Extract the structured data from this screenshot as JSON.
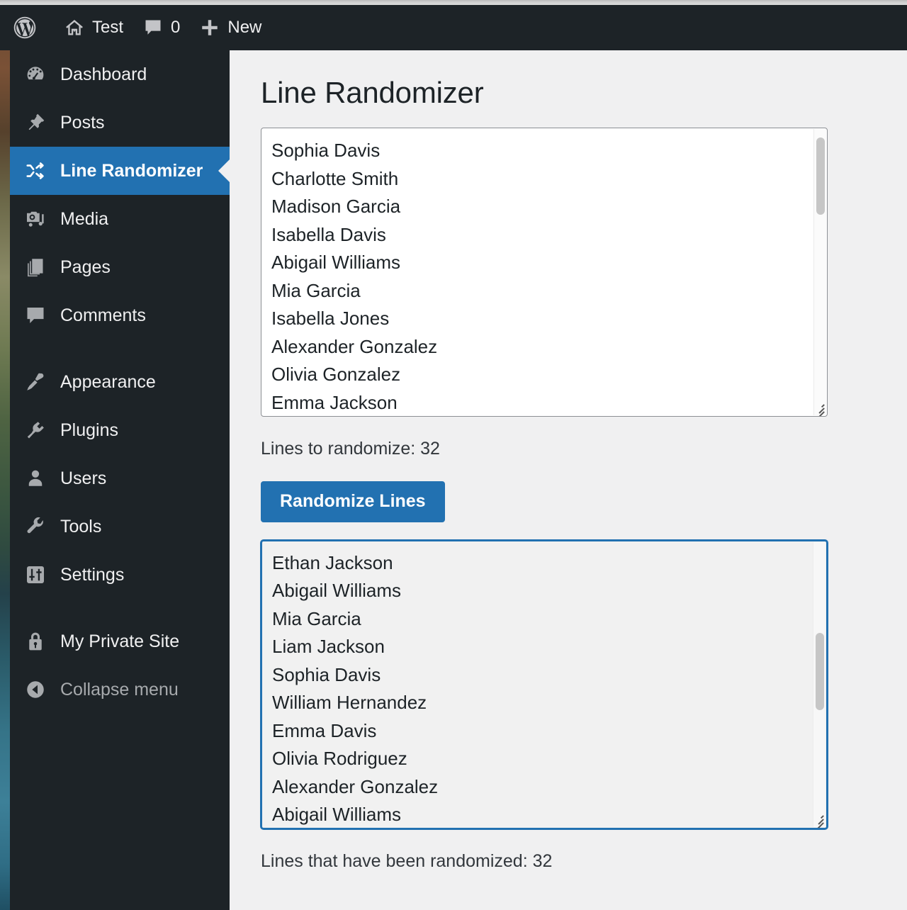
{
  "adminbar": {
    "items": [
      {
        "name": "wordpress-logo",
        "icon": "wordpress-icon",
        "label": ""
      },
      {
        "name": "site-name",
        "icon": "home-icon",
        "label": "Test"
      },
      {
        "name": "comments",
        "icon": "comment-bubble-icon",
        "label": "0"
      },
      {
        "name": "new-content",
        "icon": "plus-icon",
        "label": "New"
      }
    ]
  },
  "sidebar": {
    "items": [
      {
        "label": "Dashboard",
        "icon": "dashboard-gauge-icon",
        "current": false,
        "separator_after": false
      },
      {
        "label": "Posts",
        "icon": "pushpin-icon",
        "current": false,
        "separator_after": false
      },
      {
        "label": "Line Randomizer",
        "icon": "shuffle-icon",
        "current": true,
        "separator_after": false
      },
      {
        "label": "Media",
        "icon": "media-camera-music-icon",
        "current": false,
        "separator_after": false
      },
      {
        "label": "Pages",
        "icon": "pages-icon",
        "current": false,
        "separator_after": false
      },
      {
        "label": "Comments",
        "icon": "comment-bubble-icon",
        "current": false,
        "separator_after": true
      },
      {
        "label": "Appearance",
        "icon": "paintbrush-icon",
        "current": false,
        "separator_after": false
      },
      {
        "label": "Plugins",
        "icon": "plug-icon",
        "current": false,
        "separator_after": false
      },
      {
        "label": "Users",
        "icon": "user-icon",
        "current": false,
        "separator_after": false
      },
      {
        "label": "Tools",
        "icon": "wrench-icon",
        "current": false,
        "separator_after": false
      },
      {
        "label": "Settings",
        "icon": "sliders-icon",
        "current": false,
        "separator_after": true
      },
      {
        "label": "My Private Site",
        "icon": "lock-icon",
        "current": false,
        "separator_after": false
      }
    ],
    "collapse": {
      "label": "Collapse menu",
      "icon": "collapse-arrow-left-icon"
    }
  },
  "main": {
    "title": "Line Randomizer",
    "input_textarea": {
      "name": "input-lines-textarea",
      "visible_lines": [
        "Sophia Davis",
        "Charlotte Smith",
        "Madison Garcia",
        "Isabella Davis",
        "Abigail Williams",
        "Mia Garcia",
        "Isabella Jones",
        "Alexander Gonzalez",
        "Olivia Gonzalez",
        "Emma Jackson"
      ],
      "scroll_thumb_top_pct": 3,
      "scroll_thumb_height_pct": 27
    },
    "input_count_label": "Lines to randomize: 32",
    "randomize_button_label": "Randomize Lines",
    "output_textarea": {
      "name": "output-lines-textarea",
      "focused": true,
      "visible_lines": [
        "Ethan Jackson",
        "Abigail Williams",
        "Mia Garcia",
        "Liam Jackson",
        "Sophia Davis",
        "William Hernandez",
        "Emma Davis",
        "Olivia Rodriguez",
        "Alexander Gonzalez",
        "Abigail Williams"
      ],
      "scroll_thumb_top_pct": 32,
      "scroll_thumb_height_pct": 27
    },
    "output_count_label": "Lines that have been randomized: 32"
  },
  "colors": {
    "accent_blue": "#2271b1",
    "admin_dark": "#1d2327",
    "content_bg": "#f0f0f1",
    "icon_gray": "#a7aaad"
  }
}
